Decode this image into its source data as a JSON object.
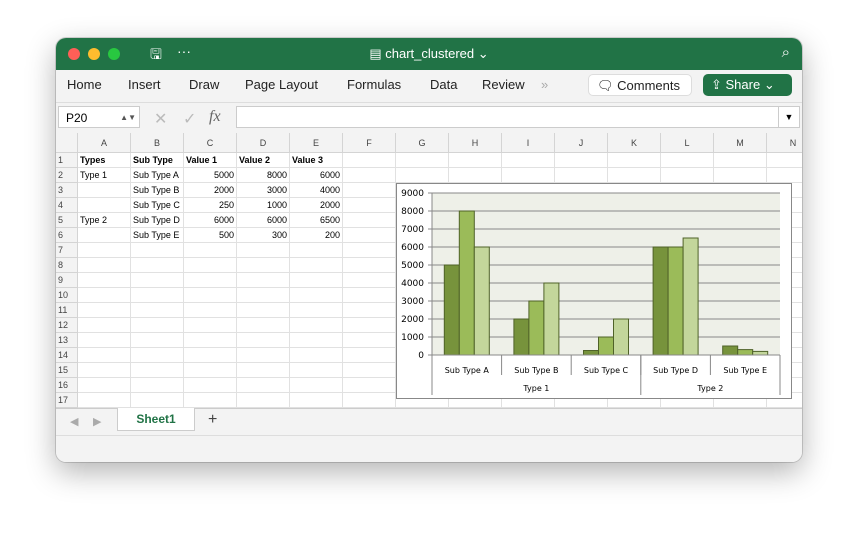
{
  "window": {
    "title": "chart_clustered"
  },
  "ribbon": {
    "tabs": [
      "Home",
      "Insert",
      "Draw",
      "Page Layout",
      "Formulas",
      "Data",
      "Review"
    ],
    "more": "»",
    "comments": "Comments",
    "share": "Share"
  },
  "formula": {
    "name_box": "P20",
    "value": ""
  },
  "sheet": {
    "columns": [
      "A",
      "B",
      "C",
      "D",
      "E",
      "F",
      "G",
      "H",
      "I",
      "J",
      "K",
      "L",
      "M",
      "N"
    ],
    "rows": [
      [
        "Types",
        "Sub Type",
        "Value 1",
        "Value 2",
        "Value 3"
      ],
      [
        "Type 1",
        "Sub Type A",
        "5000",
        "8000",
        "6000"
      ],
      [
        "",
        "Sub Type B",
        "2000",
        "3000",
        "4000"
      ],
      [
        "",
        "Sub Type C",
        "250",
        "1000",
        "2000"
      ],
      [
        "Type 2",
        "Sub Type D",
        "6000",
        "6000",
        "6500"
      ],
      [
        "",
        "Sub Type E",
        "500",
        "300",
        "200"
      ]
    ],
    "row_count": 17
  },
  "tabs": {
    "sheets": [
      "Sheet1"
    ],
    "add": "+"
  },
  "chart_data": {
    "type": "bar",
    "categories": [
      "Sub Type A",
      "Sub Type B",
      "Sub Type C",
      "Sub Type D",
      "Sub Type E"
    ],
    "groups": [
      {
        "label": "Type 1",
        "span": 3
      },
      {
        "label": "Type 2",
        "span": 2
      }
    ],
    "series": [
      {
        "name": "Value 1",
        "values": [
          5000,
          2000,
          250,
          6000,
          500
        ],
        "color": "#77933c"
      },
      {
        "name": "Value 2",
        "values": [
          8000,
          3000,
          1000,
          6000,
          300
        ],
        "color": "#9bbb59"
      },
      {
        "name": "Value 3",
        "values": [
          6000,
          4000,
          2000,
          6500,
          200
        ],
        "color": "#c3d69b"
      }
    ],
    "yticks": [
      "0",
      "1000",
      "2000",
      "3000",
      "4000",
      "5000",
      "6000",
      "7000",
      "8000",
      "9000"
    ],
    "ylim": [
      0,
      9000
    ],
    "grid": true,
    "legend": "none"
  },
  "colors": {
    "brand": "#217346",
    "plot_bg": "#eef0e8"
  }
}
